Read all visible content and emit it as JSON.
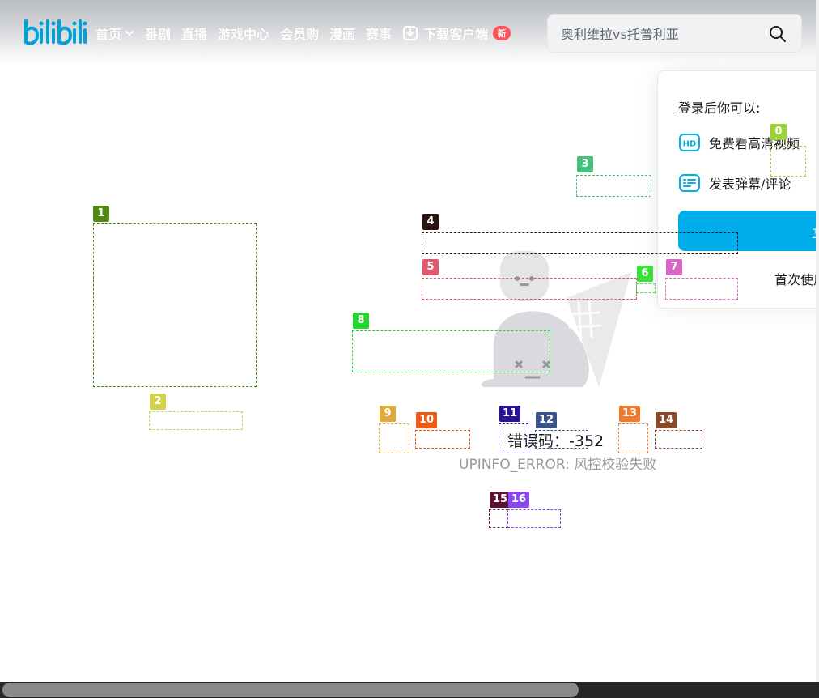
{
  "header": {
    "logo_text": "bilibili",
    "nav": [
      {
        "label": "首页",
        "has_dropdown": true
      },
      {
        "label": "番剧"
      },
      {
        "label": "直播"
      },
      {
        "label": "游戏中心"
      },
      {
        "label": "会员购"
      },
      {
        "label": "漫画"
      },
      {
        "label": "赛事"
      },
      {
        "label": "下载客户端",
        "badge": "新"
      }
    ],
    "search": {
      "placeholder": "奥利维拉vs托普利亚",
      "value": ""
    }
  },
  "login_popup": {
    "title": "登录后你可以:",
    "benefits": [
      {
        "icon": "hd-icon",
        "label": "免费看高清视频"
      },
      {
        "icon": "danmaku-icon",
        "label": "发表弹幕/评论"
      }
    ],
    "login_button": "立",
    "first_use_text": "首次使用"
  },
  "error": {
    "code_text": "错误码：-352",
    "message": "UPINFO_ERROR: 风控校验失败"
  },
  "annotation_labels": [
    "0",
    "1",
    "2",
    "3",
    "4",
    "5",
    "6",
    "7",
    "8",
    "9",
    "10",
    "11",
    "12",
    "13",
    "14",
    "15",
    "16"
  ],
  "annotation_colors": [
    "#9bd235",
    "#4d8a0f",
    "#d4d24a",
    "#46c07a",
    "#2b1410",
    "#e05a6e",
    "#38e038",
    "#d966c4",
    "#25d62c",
    "#e0a93a",
    "#f05a18",
    "#27129a",
    "#3a5585",
    "#f07a2a",
    "#8a4a2a",
    "#5a1032",
    "#8a46f0"
  ],
  "colors": {
    "brand": "#00aeec",
    "badge": "#ff4f58",
    "text": "#18191c",
    "muted": "#9499a0"
  }
}
